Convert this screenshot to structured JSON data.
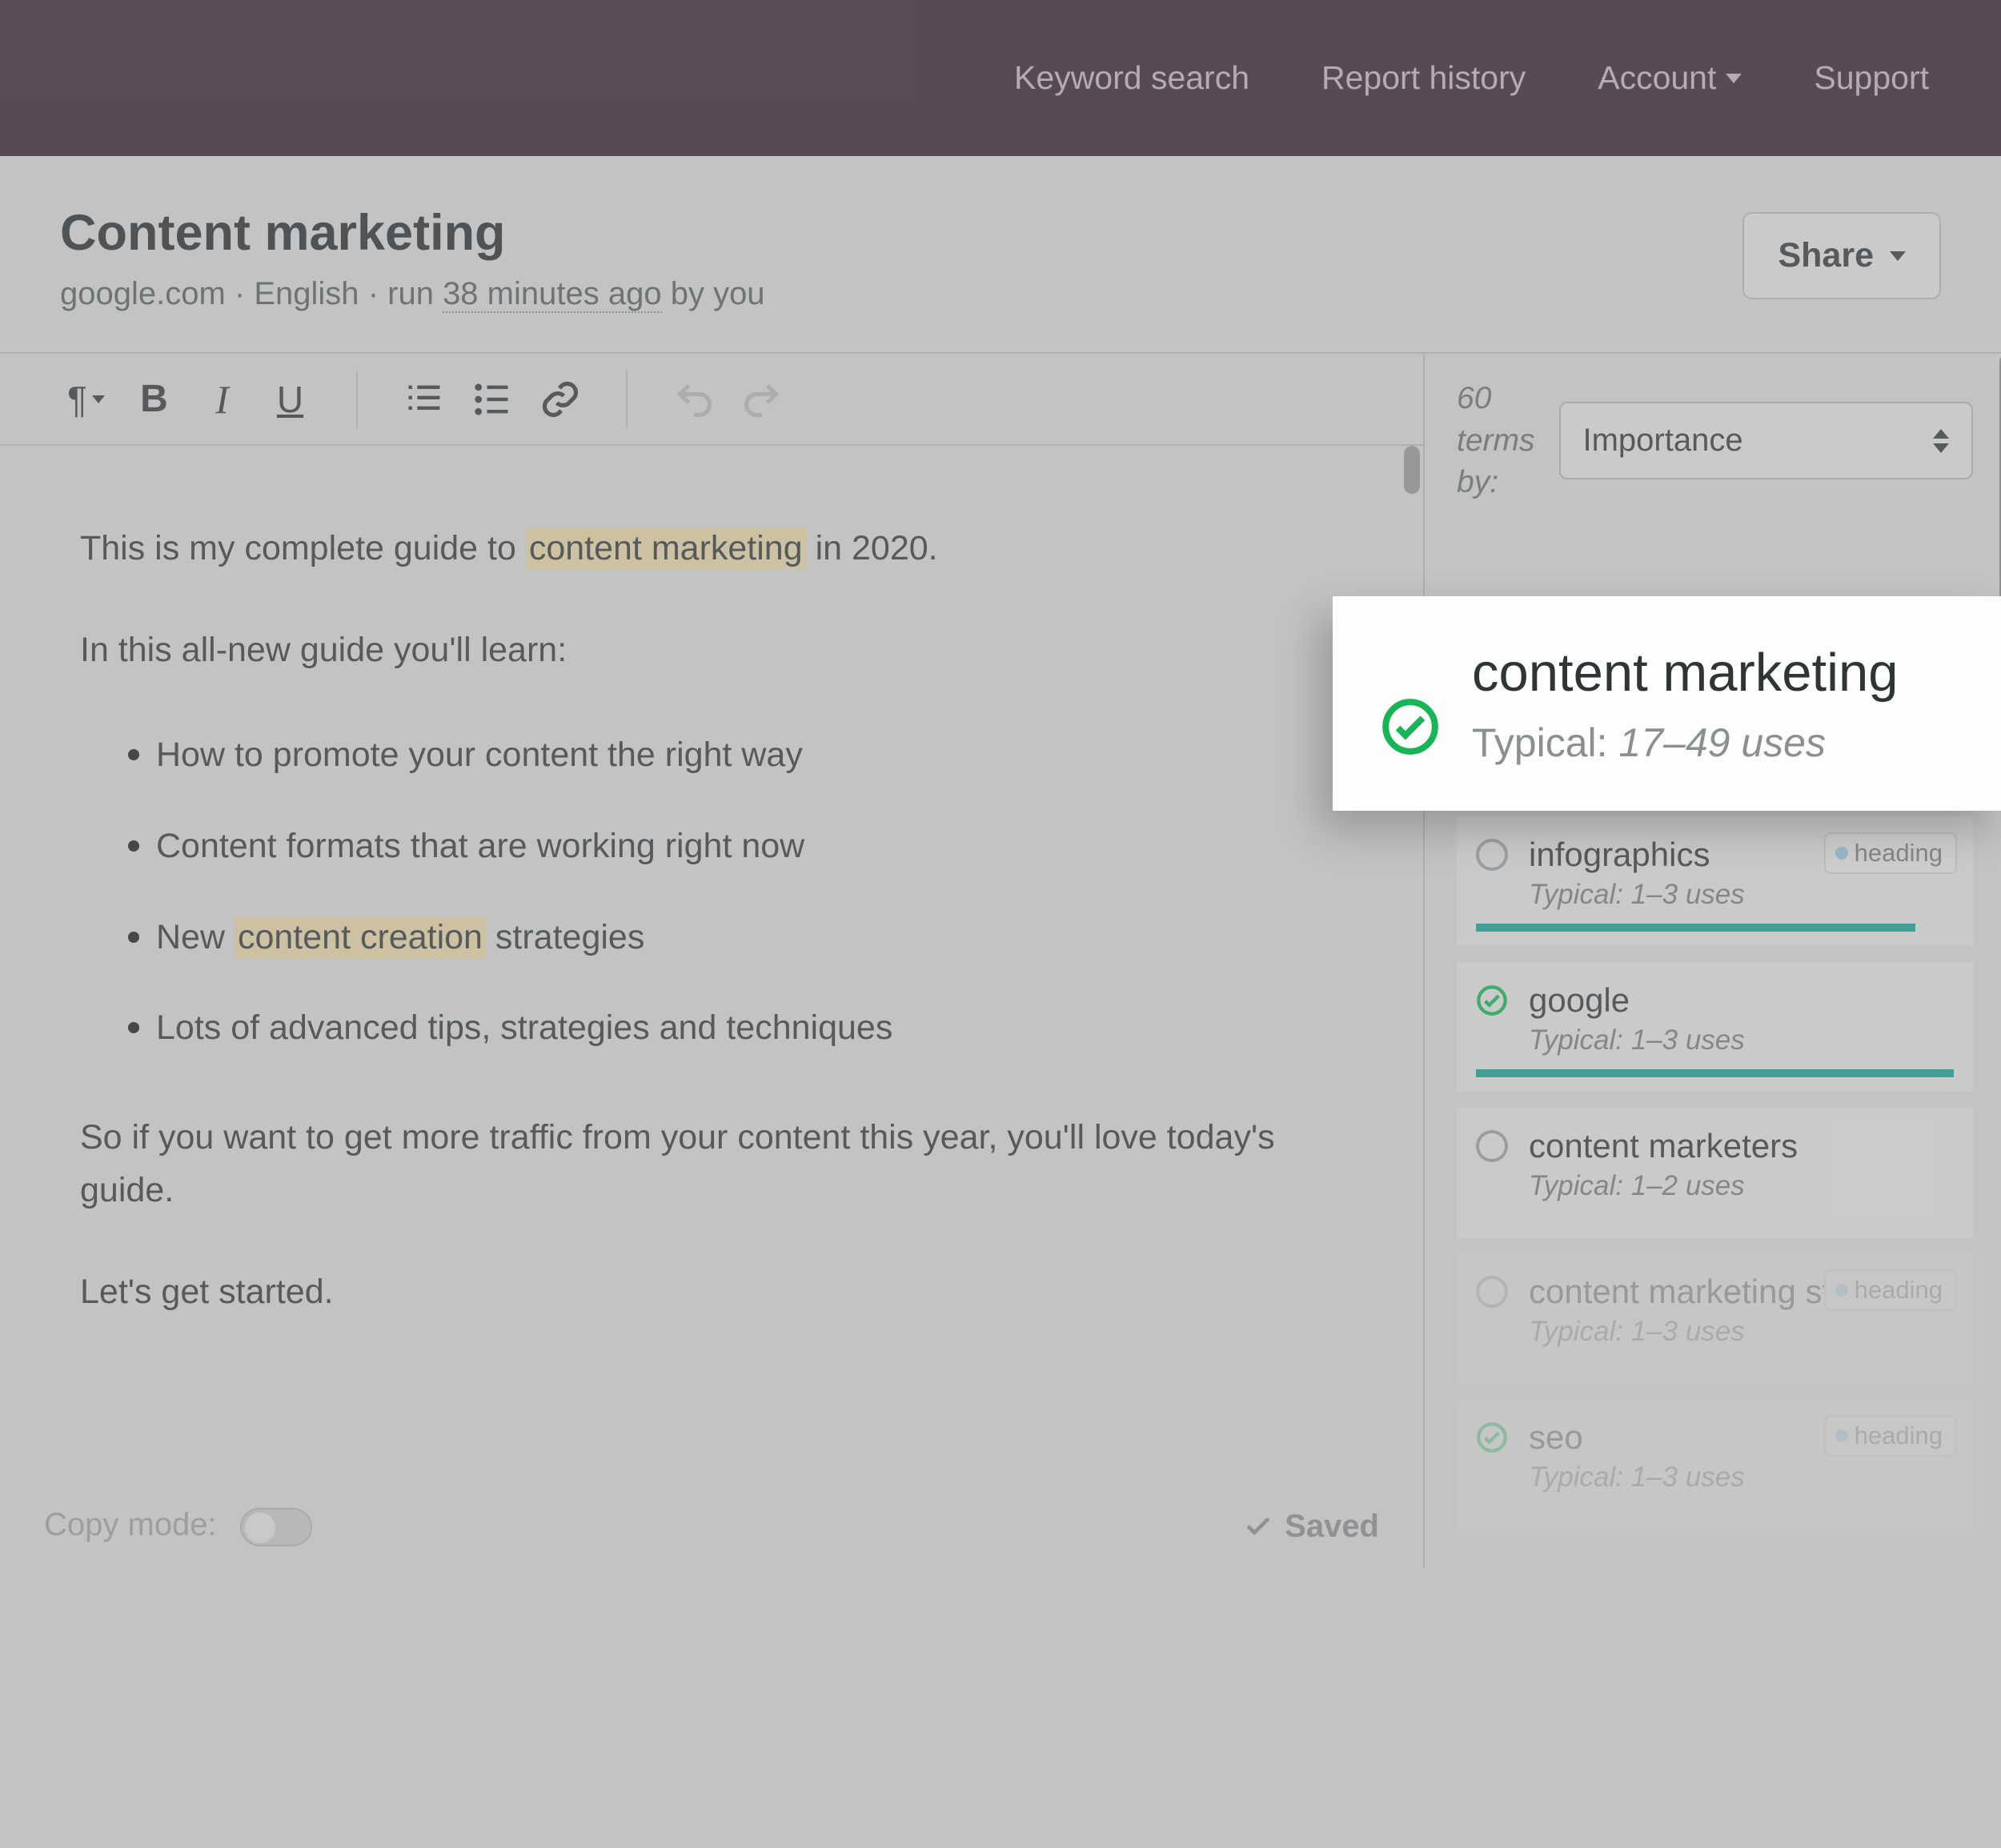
{
  "nav": {
    "keyword_search": "Keyword search",
    "report_history": "Report history",
    "account": "Account",
    "support": "Support"
  },
  "header": {
    "title": "Content marketing",
    "domain": "google.com",
    "language": "English",
    "run_prefix": "run",
    "run_time": "38 minutes ago",
    "run_by": "by you",
    "share": "Share"
  },
  "toolbar": {
    "paragraph": "¶",
    "bold": "B",
    "italic": "I",
    "underline": "U"
  },
  "editor": {
    "p1_a": "This is my complete guide to ",
    "p1_hl": "content marketing",
    "p1_b": " in 2020.",
    "p2": "In this all-new guide you'll learn:",
    "li1": "How to promote your content the right way",
    "li2": "Content formats that are working right now",
    "li3_a": "New ",
    "li3_hl": "content creation",
    "li3_b": " strategies",
    "li4": "Lots of advanced tips, strategies and techniques",
    "p3": "So if you want to get more traffic from your content this year, you'll love today's guide.",
    "p4": "Let's get started."
  },
  "footer": {
    "copy_mode": "Copy mode:",
    "saved": "Saved"
  },
  "sidebar": {
    "count": "60",
    "label_line1": "terms",
    "label_line2": "by:",
    "sort": "Importance",
    "heading_badge": "heading"
  },
  "popover": {
    "title": "content marketing",
    "typical_label": "Typical:",
    "typical_value": "17–49 uses"
  },
  "terms": [
    {
      "name": "infographics",
      "typical": "Typical: 1–3 uses",
      "status": "ring",
      "badge": true,
      "bar": 92,
      "faded": false
    },
    {
      "name": "google",
      "typical": "Typical: 1–3 uses",
      "status": "check",
      "badge": false,
      "bar": 100,
      "faded": false
    },
    {
      "name": "content marketers",
      "typical": "Typical: 1–2 uses",
      "status": "ring",
      "badge": false,
      "bar": 0,
      "faded": false
    },
    {
      "name": "content marketing strategy",
      "typical": "Typical: 1–3 uses",
      "status": "ring",
      "badge": true,
      "bar": 0,
      "faded": true
    },
    {
      "name": "seo",
      "typical": "Typical: 1–3 uses",
      "status": "check",
      "badge": true,
      "bar": 0,
      "faded": true
    }
  ]
}
